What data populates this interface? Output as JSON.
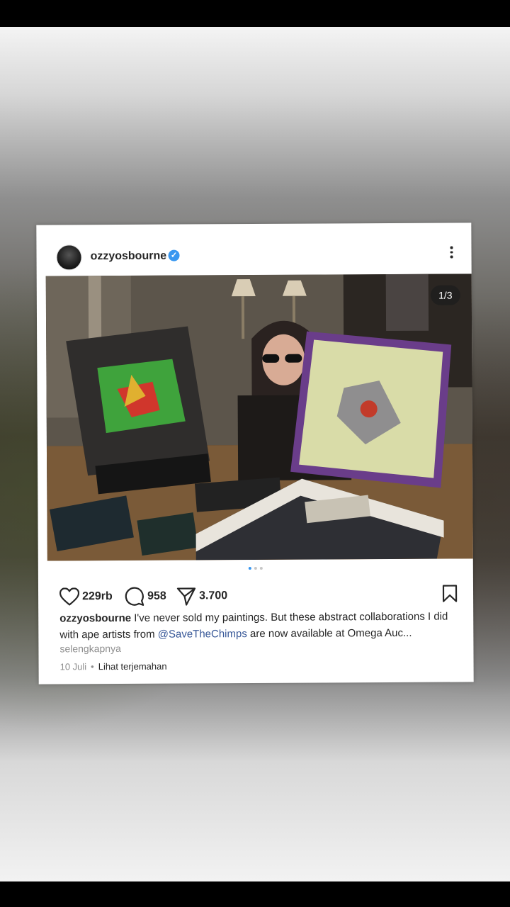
{
  "post": {
    "username": "ozzyosbourne",
    "image_counter": "1/3",
    "likes": "229rb",
    "comments": "958",
    "shares": "3.700",
    "caption_text": "I've never sold my paintings. But these abstract collaborations I did with ape artists from ",
    "caption_mention": "@SaveTheChimps",
    "caption_tail": " are now available at Omega Auc...",
    "more_label": "selengkapnya",
    "date": "10 Juli",
    "separator": "•",
    "translate_label": "Lihat terjemahan",
    "carousel_total": 3,
    "carousel_active": 1
  },
  "icons": {
    "verified": "verified-badge-icon",
    "more": "more-options-icon",
    "like": "heart-icon",
    "comment": "comment-icon",
    "share": "share-icon",
    "bookmark": "bookmark-icon"
  },
  "colors": {
    "verified": "#3897f0",
    "mention": "#385898",
    "muted": "#8e8e8e",
    "text": "#262626"
  }
}
